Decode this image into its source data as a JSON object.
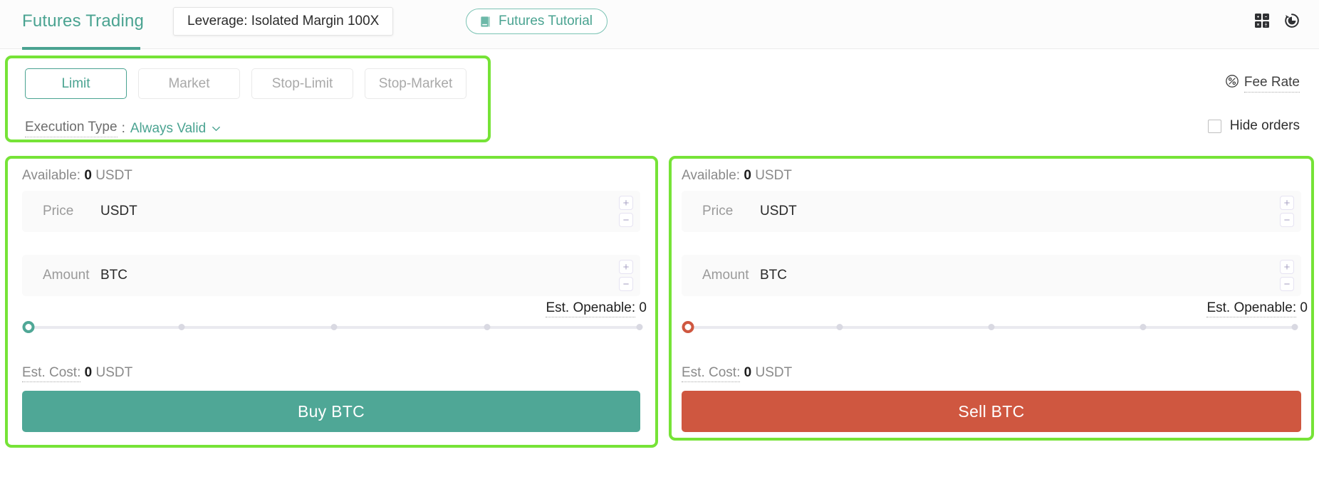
{
  "header": {
    "tab_label": "Futures Trading",
    "leverage_label": "Leverage: Isolated Margin 100X",
    "tutorial_label": "Futures Tutorial",
    "tutorial_icon": "book-icon",
    "calculator_icon": "calculator-icon",
    "history_icon": "order-history-icon"
  },
  "order_type": {
    "tabs": [
      {
        "label": "Limit",
        "active": true
      },
      {
        "label": "Market",
        "active": false
      },
      {
        "label": "Stop-Limit",
        "active": false
      },
      {
        "label": "Stop-Market",
        "active": false
      }
    ],
    "execution_type_label": "Execution Type",
    "execution_type_colon": ":",
    "execution_type_value": "Always Valid",
    "execution_caret_icon": "chevron-down-icon"
  },
  "options": {
    "fee_rate_label": "Fee Rate",
    "fee_rate_icon": "percent-circle-icon",
    "hide_orders_label": "Hide orders",
    "hide_orders_checked": false
  },
  "buy_panel": {
    "available_prefix": "Available:",
    "available_value": "0",
    "available_unit": "USDT",
    "price_label": "Price",
    "price_unit": "USDT",
    "price_value": "",
    "amount_label": "Amount",
    "amount_unit": "BTC",
    "amount_value": "",
    "est_openable_label": "Est. Openable:",
    "est_openable_value": "0",
    "slider_percent": 0,
    "est_cost_label": "Est. Cost:",
    "est_cost_value": "0",
    "est_cost_unit": "USDT",
    "submit_label": "Buy BTC",
    "accent": "#4fa796",
    "increment_icon": "plus-icon",
    "decrement_icon": "minus-icon"
  },
  "sell_panel": {
    "available_prefix": "Available:",
    "available_value": "0",
    "available_unit": "USDT",
    "price_label": "Price",
    "price_unit": "USDT",
    "price_value": "",
    "amount_label": "Amount",
    "amount_unit": "BTC",
    "amount_value": "",
    "est_openable_label": "Est. Openable:",
    "est_openable_value": "0",
    "slider_percent": 0,
    "est_cost_label": "Est. Cost:",
    "est_cost_value": "0",
    "est_cost_unit": "USDT",
    "submit_label": "Sell BTC",
    "accent": "#cf5740",
    "increment_icon": "plus-icon",
    "decrement_icon": "minus-icon"
  },
  "highlight_color": "#76e337"
}
